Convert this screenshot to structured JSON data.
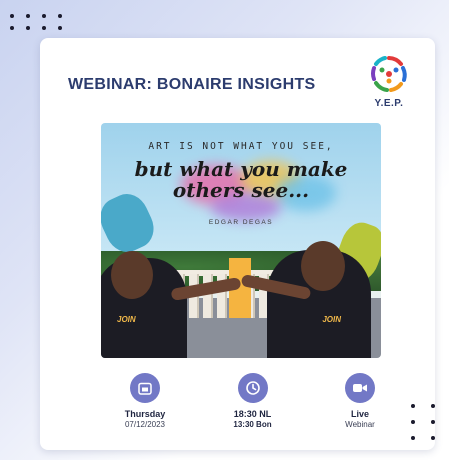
{
  "header": {
    "title": "WEBINAR: BONAIRE INSIGHTS",
    "logo_text": "Y.E.P."
  },
  "poster": {
    "quote_line1": "ART IS NOT WHAT YOU SEE,",
    "quote_line2a": "but what you make",
    "quote_line2b": "others see...",
    "author": "EDGAR DEGAS"
  },
  "details": [
    {
      "icon": "calendar-icon",
      "line1": "Thursday",
      "line2": "07/12/2023"
    },
    {
      "icon": "clock-icon",
      "line1": "18:30 NL",
      "line2": "13:30 Bon"
    },
    {
      "icon": "video-camera-icon",
      "line1": "Live",
      "line2": "Webinar"
    }
  ],
  "colors": {
    "title": "#2c3c6e",
    "icon_circle": "#7278c6",
    "background": "#c9d3f0"
  }
}
